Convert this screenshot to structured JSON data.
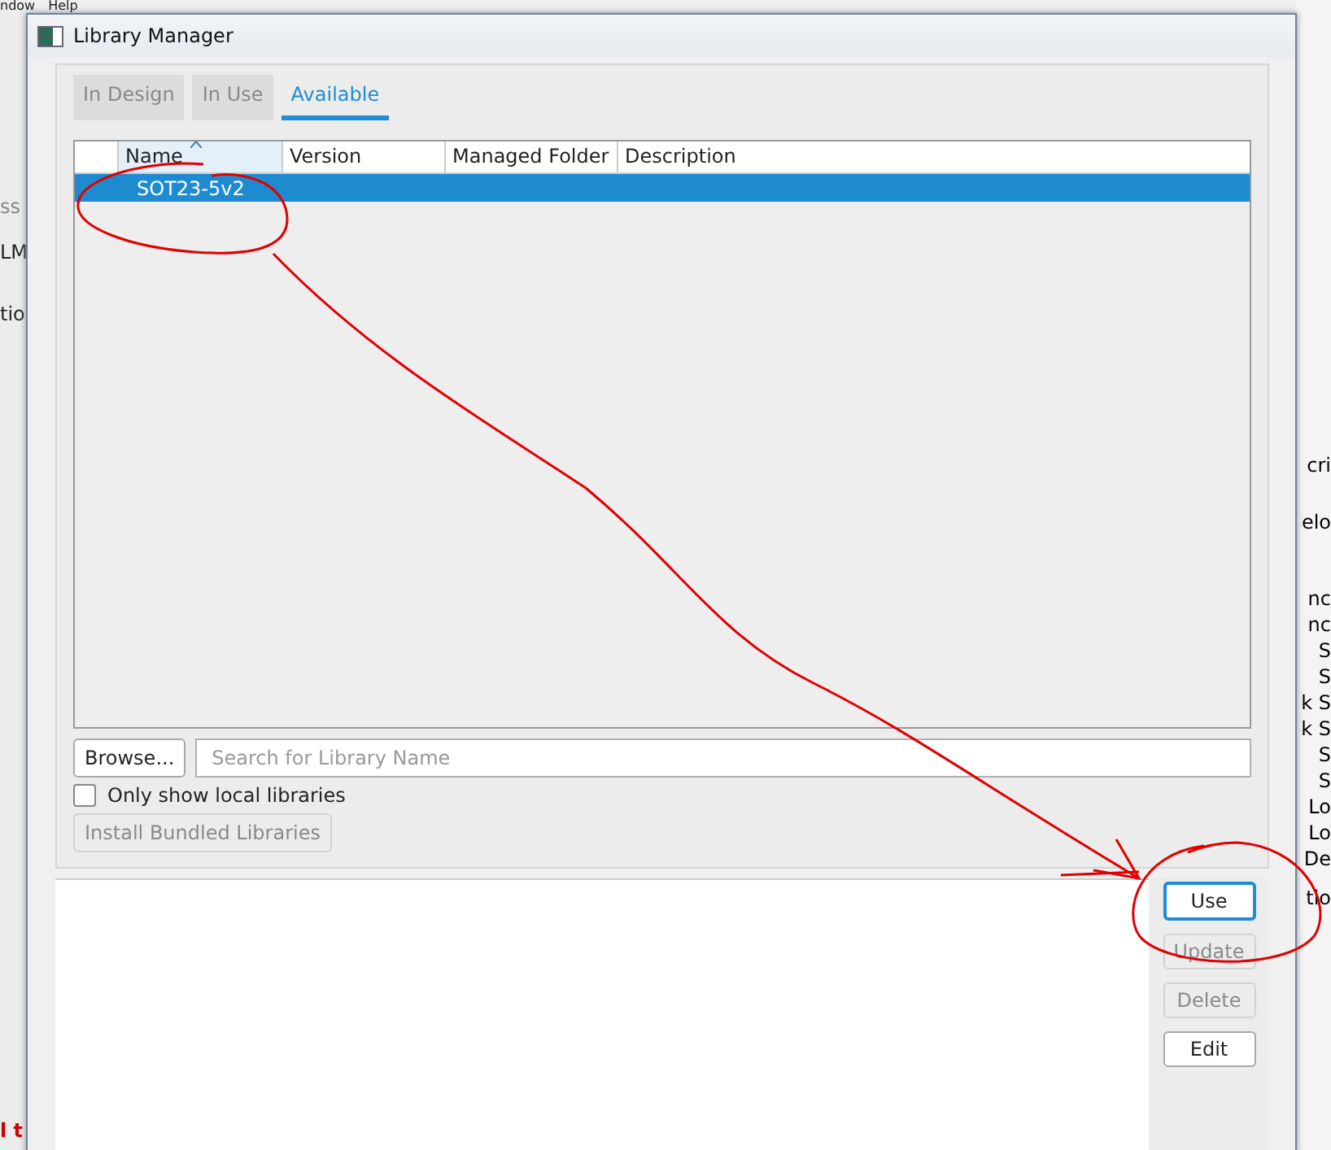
{
  "background_app": {
    "menu": [
      "ndow",
      "Help"
    ],
    "left_fragments": [
      {
        "text": "ss",
        "color": "#888888"
      },
      {
        "text": "LM",
        "color": "#222222"
      },
      {
        "text": "tio",
        "color": "#222222"
      },
      {
        "text": "l t",
        "color": "#cc0000"
      }
    ],
    "right_fragments": [
      "cri",
      "elo",
      "nc",
      "nc",
      "S",
      "S",
      "k S",
      "k S",
      "S",
      "S",
      "Lo",
      "Lo",
      "De",
      "tio"
    ]
  },
  "window": {
    "title": "Library Manager"
  },
  "tabs": [
    {
      "label": "In Design",
      "selected": false
    },
    {
      "label": "In Use",
      "selected": false
    },
    {
      "label": "Available",
      "selected": true
    }
  ],
  "table": {
    "columns": [
      {
        "label": "Name",
        "sorted": true
      },
      {
        "label": "Version",
        "sorted": false
      },
      {
        "label": "Managed Folder",
        "sorted": false
      },
      {
        "label": "Description",
        "sorted": false
      }
    ],
    "rows": [
      {
        "cells": [
          "SOT23-5v2"
        ],
        "selected": true
      }
    ]
  },
  "browse_button": "Browse...",
  "search": {
    "placeholder": "Search for Library Name"
  },
  "local_only": {
    "label": "Only show local libraries",
    "checked": false
  },
  "install_button": {
    "label": "Install Bundled Libraries",
    "disabled": true
  },
  "actions": [
    {
      "label": "Use",
      "disabled": false,
      "focused": true
    },
    {
      "label": "Update",
      "disabled": true,
      "focused": false
    },
    {
      "label": "Delete",
      "disabled": true,
      "focused": false
    },
    {
      "label": "Edit",
      "disabled": false,
      "focused": false
    }
  ]
}
